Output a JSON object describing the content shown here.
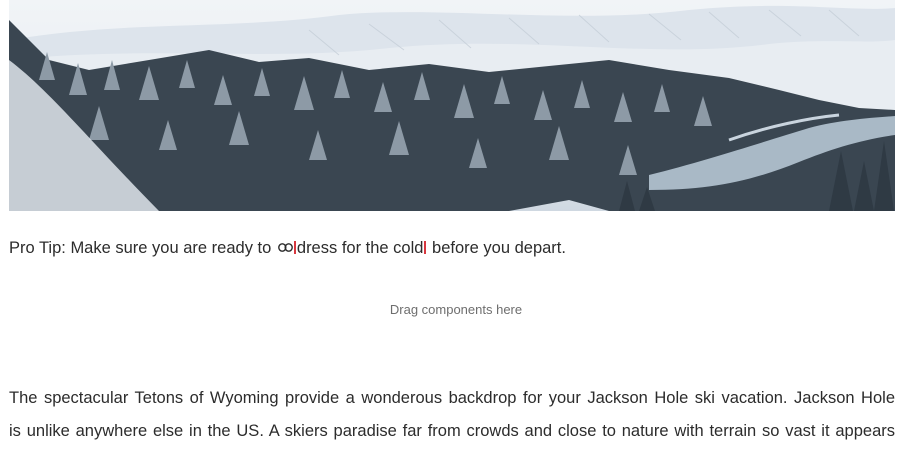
{
  "hero_image": {
    "icon": "snowy-forest-landscape",
    "colors": {
      "sky": "#eef2f6",
      "hills": "#e3e8ef",
      "trees": "#2f3a44",
      "river": "#a9b9c6"
    }
  },
  "tip": {
    "before": "Pro Tip: Make sure you are ready to ",
    "link_text": "dress for the cold",
    "after": " before you depart.",
    "link_icon": "link-icon",
    "marker_color": "#d7373f"
  },
  "dropzone": {
    "label": "Drag components here"
  },
  "article": {
    "lines": [
      "The spectacular Tetons of Wyoming provide a wonderous backdrop for your Jackson Hole ski vacation.  Jackson Hole",
      "is unlike anywhere else in the US.  A skiers paradise far from crowds and close to nature with terrain so vast it appears"
    ]
  }
}
